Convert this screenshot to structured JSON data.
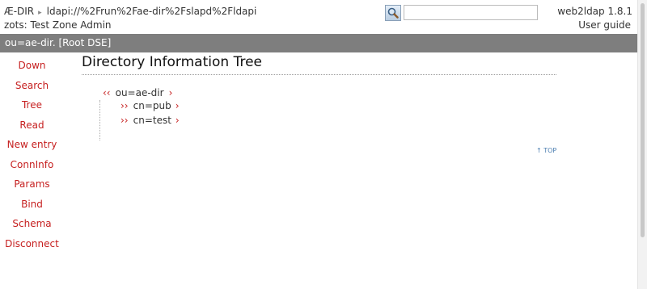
{
  "header": {
    "app_name": "Æ-DIR",
    "arrow": "▸",
    "ldap_url": "ldapi://%2Frun%2Fae-dir%2Fslapd%2Fldapi",
    "who_am_i": "zots: Test Zone Admin",
    "version": "web2ldap 1.8.1",
    "user_guide": "User guide",
    "search_value": "",
    "search_placeholder": ""
  },
  "dn_bar": {
    "text": "ou=ae-dir. [Root DSE]"
  },
  "menu": {
    "down": "Down",
    "search": "Search",
    "tree": "Tree",
    "read": "Read",
    "new_entry": "New entry",
    "conninfo": "ConnInfo",
    "params": "Params",
    "bind": "Bind",
    "schema": "Schema",
    "disconnect": "Disconnect"
  },
  "main": {
    "title": "Directory Information Tree",
    "tree": {
      "collapse_symbol": "‹‹",
      "expand_symbol": "››",
      "read_symbol": "›",
      "root_label": "ou=ae-dir",
      "children": [
        {
          "label": "cn=pub"
        },
        {
          "label": "cn=test"
        }
      ]
    },
    "top_link": "↑ TOP"
  },
  "colors": {
    "link_red": "#c62020",
    "band_grey": "#7e7e7e",
    "top_link_blue": "#4a7db0"
  },
  "icons": {
    "search_button": "magnifier-icon",
    "breadcrumb_arrow": "triangle-right-icon"
  }
}
